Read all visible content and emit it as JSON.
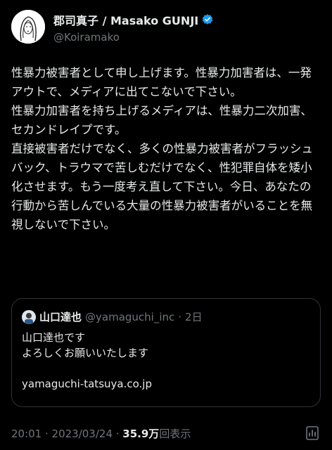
{
  "author": {
    "display_name": "郡司真子 / Masako GUNJI",
    "handle": "@Koiramako",
    "avatar_icon": "portrait-avatar-icon",
    "verified_icon": "verified-badge-icon",
    "verified_color": "#1d9bf0"
  },
  "tweet": {
    "text": "性暴力被害者として申し上げます。性暴力加害者は、一発アウトで、メディアに出てこないで下さい。\n性暴力加害者を持ち上げるメディアは、性暴力二次加害、セカンドレイプです。\n直接被害者だけでなく、多くの性暴力被害者がフラッシュバック、トラウマで苦しむだけでなく、性犯罪自体を矮小化させます。もう一度考え直して下さい。今日、あなたの行動から苦しんでいる大量の性暴力被害者がいることを無視しないで下さい。"
  },
  "quoted": {
    "display_name": "山口達也",
    "handle": "@yamaguchi_inc",
    "separator": "·",
    "time": "2日",
    "text": "山口達也です\nよろしくお願いいたします\n\nyamaguchi-tatsuya.co.jp"
  },
  "meta": {
    "time": "20:01 · 2023/03/24 · ",
    "views_count": "35.9万",
    "views_label": "回表示",
    "analytics_icon": "analytics-icon"
  }
}
